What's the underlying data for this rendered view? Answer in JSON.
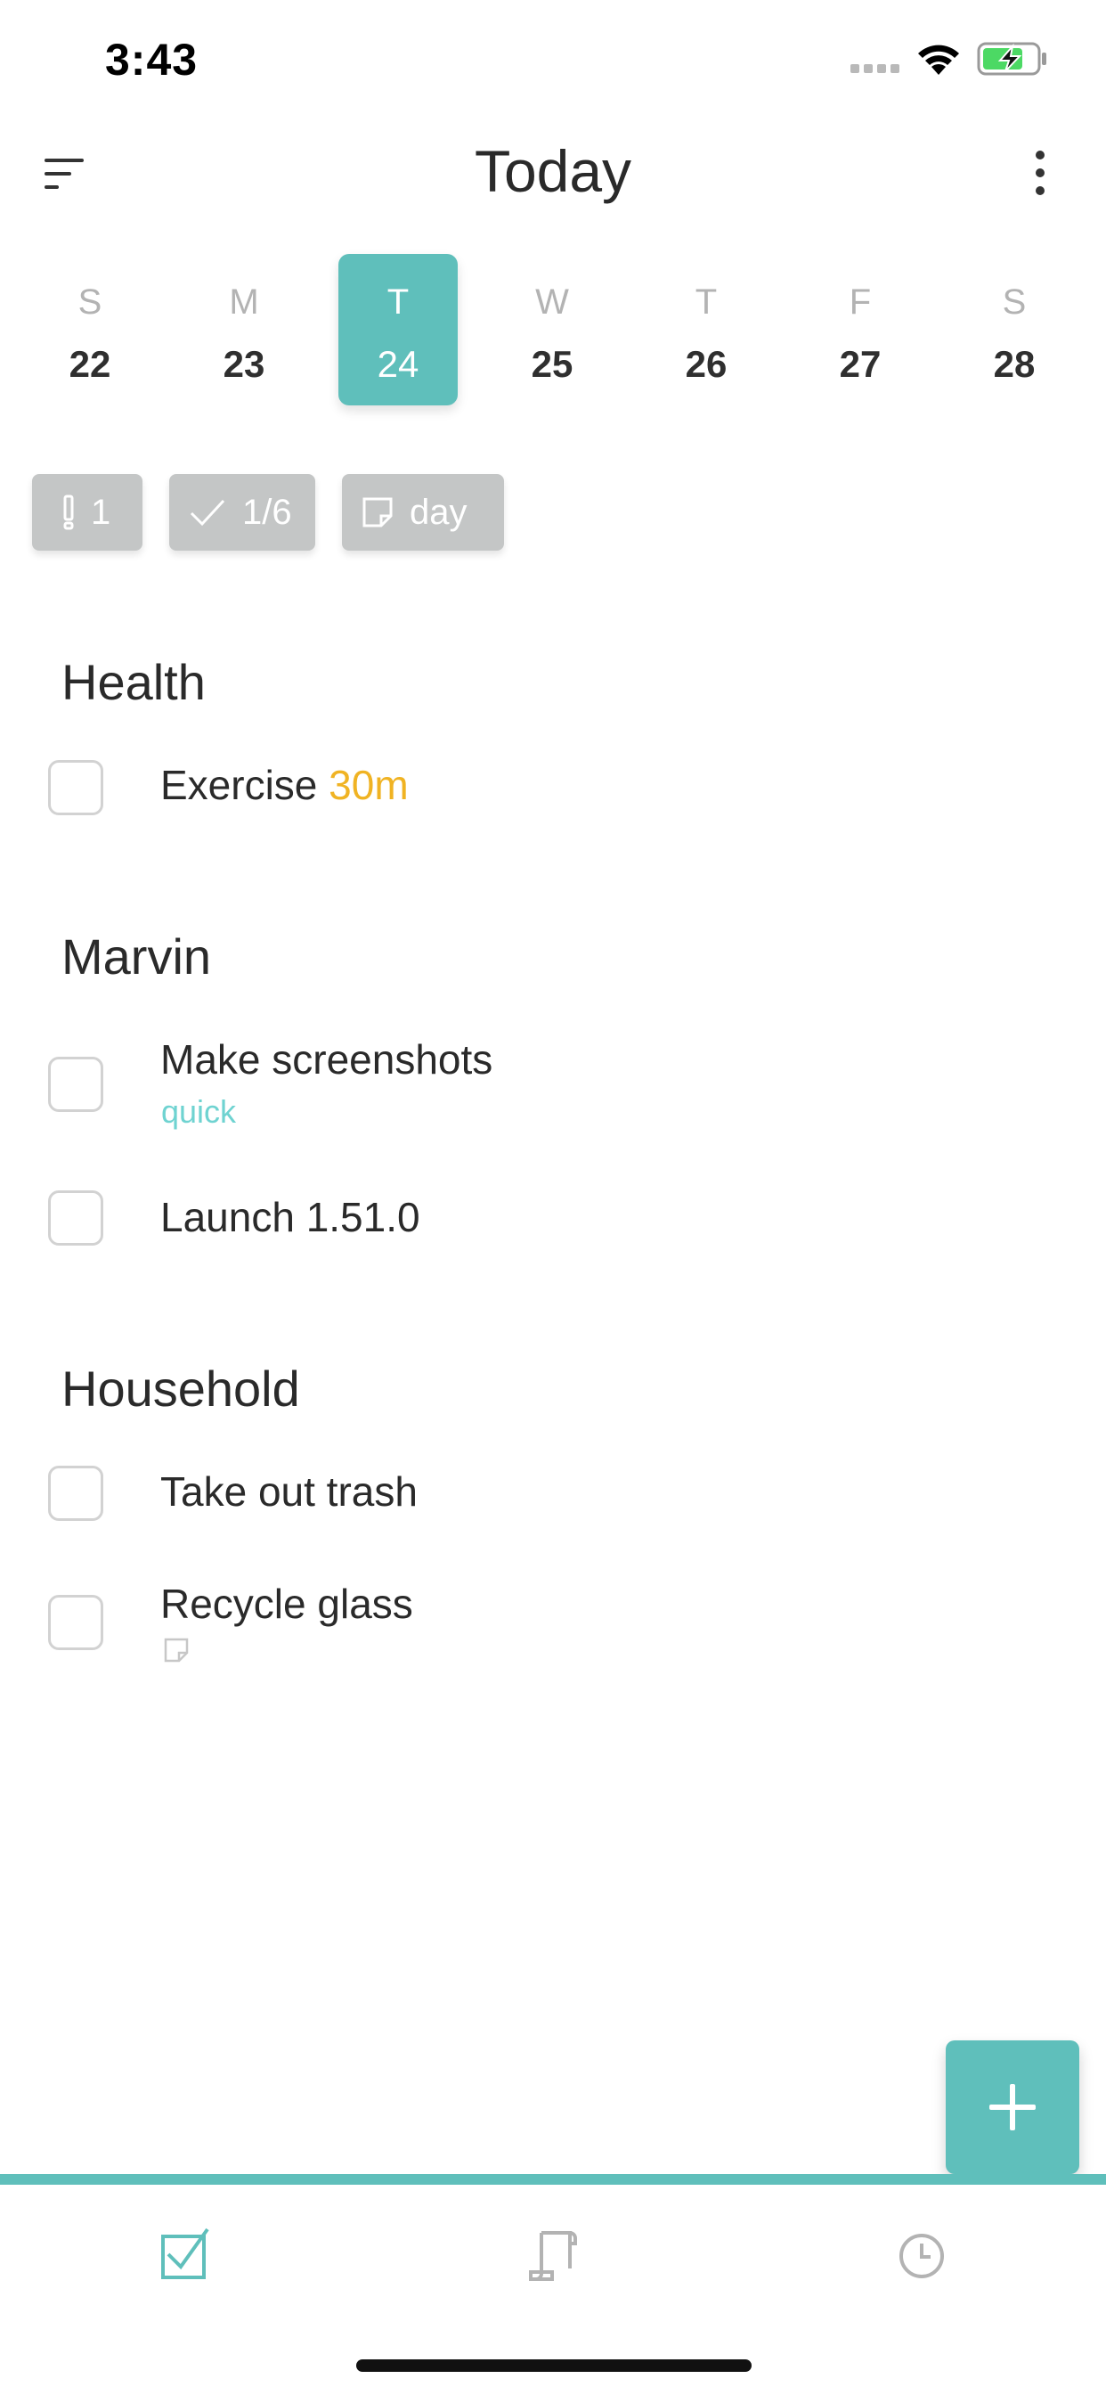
{
  "status_bar": {
    "time": "3:43"
  },
  "header": {
    "title": "Today"
  },
  "week": [
    {
      "dow": "S",
      "date": "22"
    },
    {
      "dow": "M",
      "date": "23"
    },
    {
      "dow": "T",
      "date": "24",
      "selected": true
    },
    {
      "dow": "W",
      "date": "25"
    },
    {
      "dow": "T",
      "date": "26"
    },
    {
      "dow": "F",
      "date": "27"
    },
    {
      "dow": "S",
      "date": "28"
    }
  ],
  "chips": {
    "priority": {
      "icon": "exclamation-icon",
      "label": "1"
    },
    "done": {
      "icon": "check-icon",
      "label": "1/6"
    },
    "notes": {
      "icon": "note-icon",
      "label": "day"
    }
  },
  "sections": [
    {
      "title": "Health",
      "tasks": [
        {
          "title": "Exercise",
          "time_estimate": "30m"
        }
      ]
    },
    {
      "title": "Marvin",
      "tasks": [
        {
          "title": "Make screenshots",
          "label": "quick"
        },
        {
          "title": "Launch 1.51.0"
        }
      ]
    },
    {
      "title": "Household",
      "tasks": [
        {
          "title": "Take out trash"
        },
        {
          "title": "Recycle glass",
          "has_note": true
        }
      ]
    }
  ],
  "tabs": [
    {
      "icon": "checkbox-icon",
      "active": true
    },
    {
      "icon": "scroll-icon"
    },
    {
      "icon": "clock-icon"
    }
  ],
  "colors": {
    "accent": "#5fbfbb",
    "time_estimate": "#f0b323",
    "label": "#6fd3d1",
    "chip": "#c4c6c6"
  }
}
